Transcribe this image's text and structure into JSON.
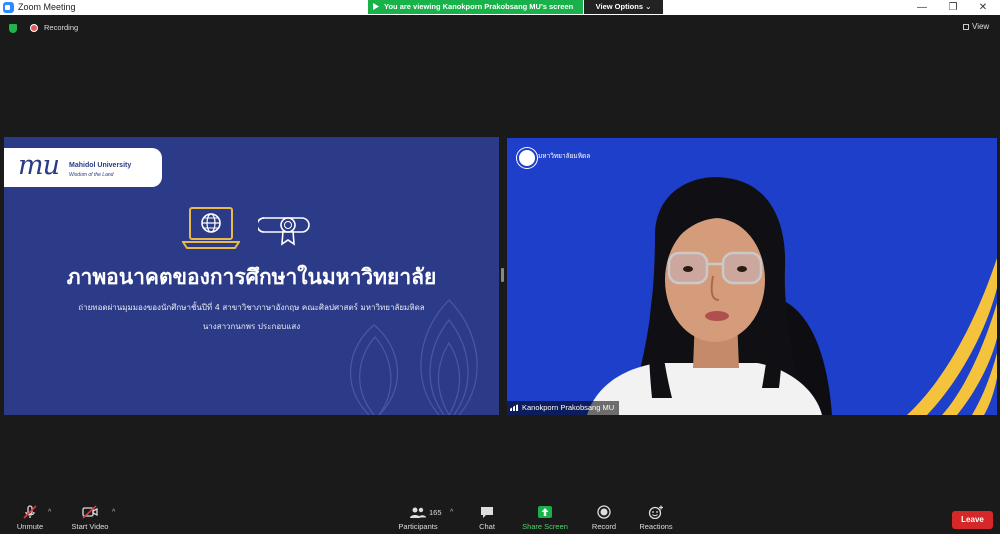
{
  "window": {
    "title": "Zoom Meeting",
    "controls": {
      "minimize": "—",
      "maximize": "❐",
      "close": "✕"
    }
  },
  "share_banner": {
    "text": "You are viewing Kanokporn Prakobsang MU's screen",
    "view_options": "View Options ⌄"
  },
  "topbar": {
    "recording_label": "Recording",
    "view_label": "View"
  },
  "slide": {
    "logo_mu": "mu",
    "logo_name": "Mahidol University",
    "logo_tagline": "Wisdom of the Land",
    "title": "ภาพอนาคตของการศึกษาในมหาวิทยาลัย",
    "subtitle": "ถ่ายทอดผ่านมุมมองของนักศึกษาชั้นปีที่ 4 สาขาวิชาภาษาอังกฤษ คณะศิลปศาสตร์ มหาวิทยาลัยมหิดล",
    "author": "นางสาวกนกพร ประกอบแสง"
  },
  "video": {
    "logo_text": "มหาวิทยาลัยมหิดล",
    "participant_name": "Kanokporn Prakobsang MU"
  },
  "toolbar": {
    "unmute": "Unmute",
    "start_video": "Start Video",
    "participants": "Participants",
    "participants_count": "165",
    "chat": "Chat",
    "share_screen": "Share Screen",
    "record": "Record",
    "reactions": "Reactions",
    "leave": "Leave",
    "caret": "^"
  },
  "colors": {
    "share_green": "#19b24a",
    "slide_bg": "#2c3b87",
    "video_bg": "#1e3fc9",
    "leave_red": "#d62828",
    "stripe_gold": "#f5c33b"
  }
}
